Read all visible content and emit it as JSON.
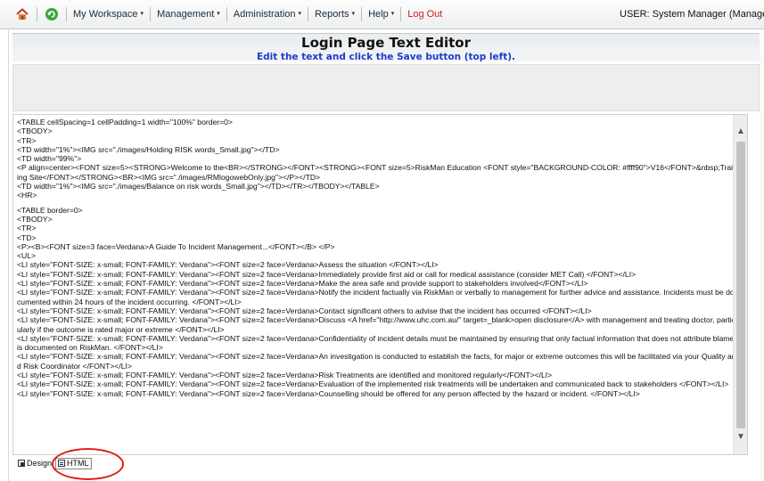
{
  "menubar": {
    "items": [
      {
        "label": "My Workspace"
      },
      {
        "label": "Management"
      },
      {
        "label": "Administration"
      },
      {
        "label": "Reports"
      },
      {
        "label": "Help"
      }
    ],
    "caret": "▾",
    "logout": "Log Out",
    "user": "USER: System Manager (Manage"
  },
  "page": {
    "title": "Login Page Text Editor",
    "subtitle": "Edit the text and click the Save button (top left)."
  },
  "editor": {
    "lines": [
      "<TABLE cellSpacing=1 cellPadding=1 width=\"100%\" border=0>",
      "<TBODY>",
      "<TR>",
      "<TD width=\"1%\"><IMG src=\"./images/Holding RISK words_Small.jpg\"></TD>",
      "<TD width=\"99%\">",
      "<P align=center><FONT size=5><STRONG>Welcome to the<BR></STRONG></FONT><STRONG><FONT size=5>RiskMan Education <FONT style=\"BACKGROUND-COLOR: #ffff90\">V16</FONT>&nbsp;Training Site</FONT></STRONG><BR><IMG src=\"./images/RMlogowebOnly.jpg\"></P></TD>",
      "<TD width=\"1%\"><IMG src=\"./images/Balance on risk words_Small.jpg\"></TD></TR></TBODY></TABLE>",
      "<HR>",
      "",
      "<TABLE border=0>",
      "<TBODY>",
      "<TR>",
      "<TD>",
      "<P><B><FONT size=3 face=Verdana>A Guide To Incident Management...</FONT></B> </P>",
      "<UL>",
      "<LI style=\"FONT-SIZE: x-small; FONT-FAMILY: Verdana\"><FONT size=2 face=Verdana>Assess the situation </FONT></LI>",
      "<LI style=\"FONT-SIZE: x-small; FONT-FAMILY: Verdana\"><FONT size=2 face=Verdana>Immediately provide first aid or call for medical assistance (consider MET Call) </FONT></LI>",
      "<LI style=\"FONT-SIZE: x-small; FONT-FAMILY: Verdana\"><FONT size=2 face=Verdana>Make the area safe and provide support to stakeholders involved</FONT></LI>",
      "<LI style=\"FONT-SIZE: x-small; FONT-FAMILY: Verdana\"><FONT size=2 face=Verdana>Notify the incident factually via RiskMan or verbally to management for further advice and assistance. Incidents must be documented within 24 hours of the incident occurring. </FONT></LI>",
      "<LI style=\"FONT-SIZE: x-small; FONT-FAMILY: Verdana\"><FONT size=2 face=Verdana>Contact significant others to advise that the incident has occurred </FONT></LI>",
      "<LI style=\"FONT-SIZE: x-small; FONT-FAMILY: Verdana\"><FONT size=2 face=Verdana>Discuss <A href=\"http://www.uhc.com.au/\" target=_blank>open disclosure</A> with management and treating doctor, particularly if the outcome is rated major or extreme </FONT></LI>",
      "<LI style=\"FONT-SIZE: x-small; FONT-FAMILY: Verdana\"><FONT size=2 face=Verdana>Confidentiality of incident details must be maintained by ensuring that only factual information that does not attribute blame is documented on RiskMan. </FONT></LI>",
      "<LI style=\"FONT-SIZE: x-small; FONT-FAMILY: Verdana\"><FONT size=2 face=Verdana>An investigation is conducted to establish the facts, for major or extreme outcomes this will be facilitated via your Quality and Risk Coordinator </FONT></LI>",
      "<LI style=\"FONT-SIZE: x-small; FONT-FAMILY: Verdana\"><FONT size=2 face=Verdana>Risk Treatments are identified and monitored regularly</FONT></LI>",
      "<LI style=\"FONT-SIZE: x-small; FONT-FAMILY: Verdana\"><FONT size=2 face=Verdana>Evaluation of the implemented risk treatments will be undertaken and communicated back to stakeholders </FONT></LI>",
      "<LI style=\"FONT-SIZE: x-small; FONT-FAMILY: Verdana\"><FONT size=2 face=Verdana>Counselling should be offered for any person affected by the hazard or incident. </FONT></LI>"
    ]
  },
  "tabs": {
    "design": "Design",
    "html": "HTML"
  },
  "icons": {
    "home": "home-icon",
    "refresh": "refresh-icon",
    "scroll_up": "▲",
    "scroll_down": "▼"
  },
  "colors": {
    "logout": "#d01c1c",
    "subtitle": "#1c3ccc",
    "annotation": "#e01c1c"
  }
}
